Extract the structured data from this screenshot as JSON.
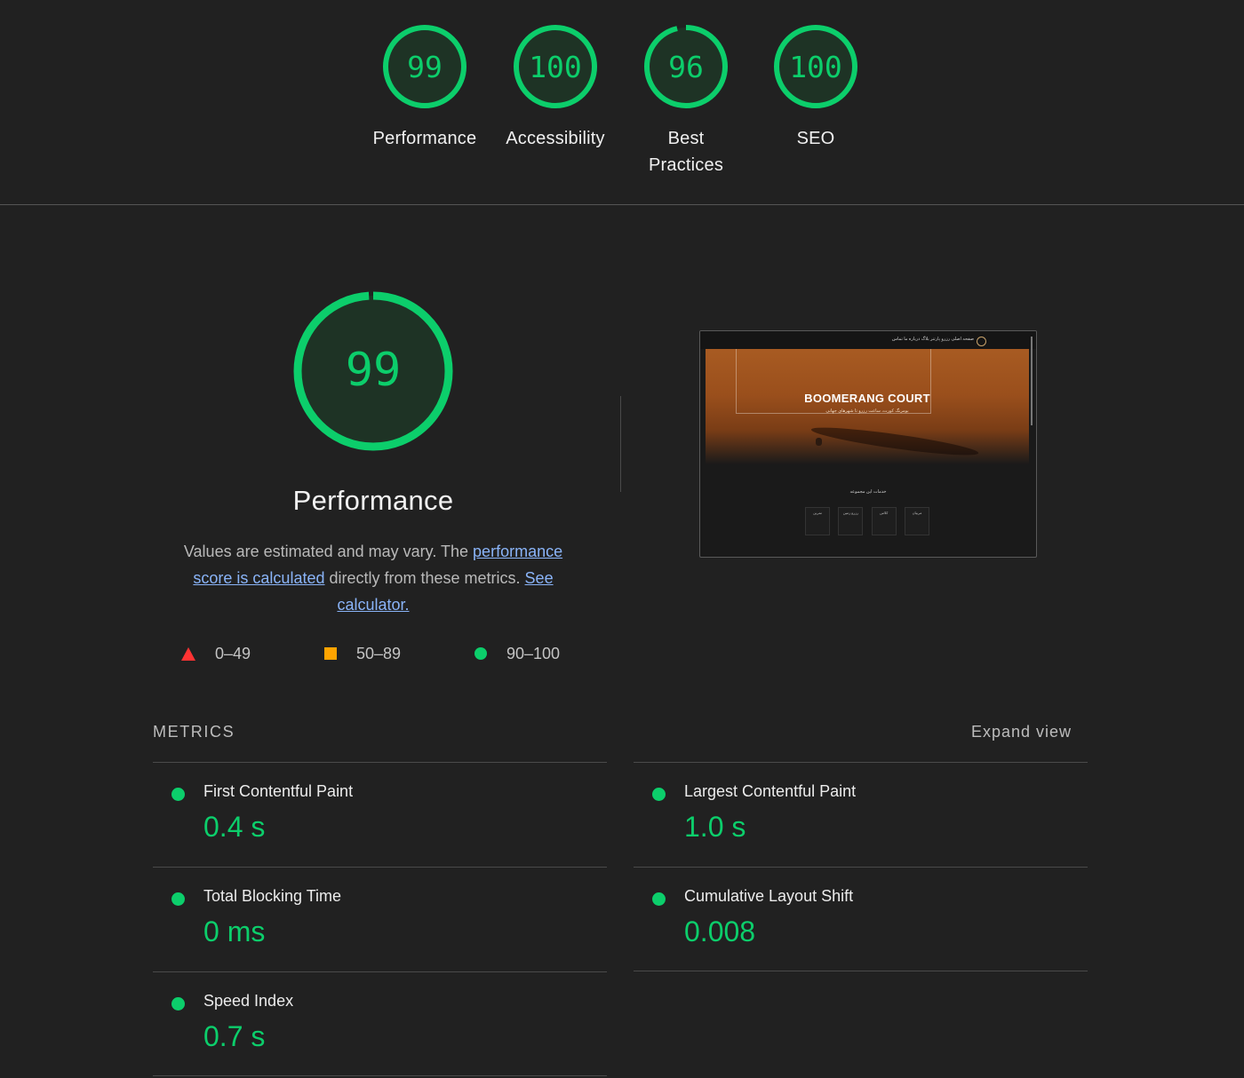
{
  "categories": [
    {
      "score": "99",
      "label": "Performance"
    },
    {
      "score": "100",
      "label": "Accessibility"
    },
    {
      "score": "96",
      "label": "Best Practices"
    },
    {
      "score": "100",
      "label": "SEO"
    }
  ],
  "performance": {
    "score": "99",
    "title": "Performance",
    "desc_before": "Values are estimated and may vary. The ",
    "desc_link1": "performance score is calculated",
    "desc_middle": " directly from these metrics. ",
    "desc_link2": "See calculator."
  },
  "legend": {
    "fail": "0–49",
    "average": "50–89",
    "pass": "90–100"
  },
  "screenshot": {
    "title": "BOOMERANG COURT",
    "subtitle": "بومرنگ کورت، ساعت رزرو تا شهرهای جهانی",
    "nav": "صفحه اصلی  رزرو  پارتنر  بلاگ  درباره ما  تماس",
    "section": "خدمات این مجموعه",
    "cards": [
      "تمرین",
      "رزرو زمین",
      "کلاس",
      "مربیان"
    ]
  },
  "metrics": {
    "title": "METRICS",
    "expand": "Expand view",
    "items": [
      {
        "name": "First Contentful Paint",
        "value": "0.4 s"
      },
      {
        "name": "Largest Contentful Paint",
        "value": "1.0 s"
      },
      {
        "name": "Total Blocking Time",
        "value": "0 ms"
      },
      {
        "name": "Cumulative Layout Shift",
        "value": "0.008"
      },
      {
        "name": "Speed Index",
        "value": "0.7 s"
      }
    ]
  },
  "colors": {
    "pass": "#0cce6b",
    "average": "#ffa400",
    "fail": "#ff3333",
    "background": "#212121",
    "link": "#8ab4f8"
  }
}
